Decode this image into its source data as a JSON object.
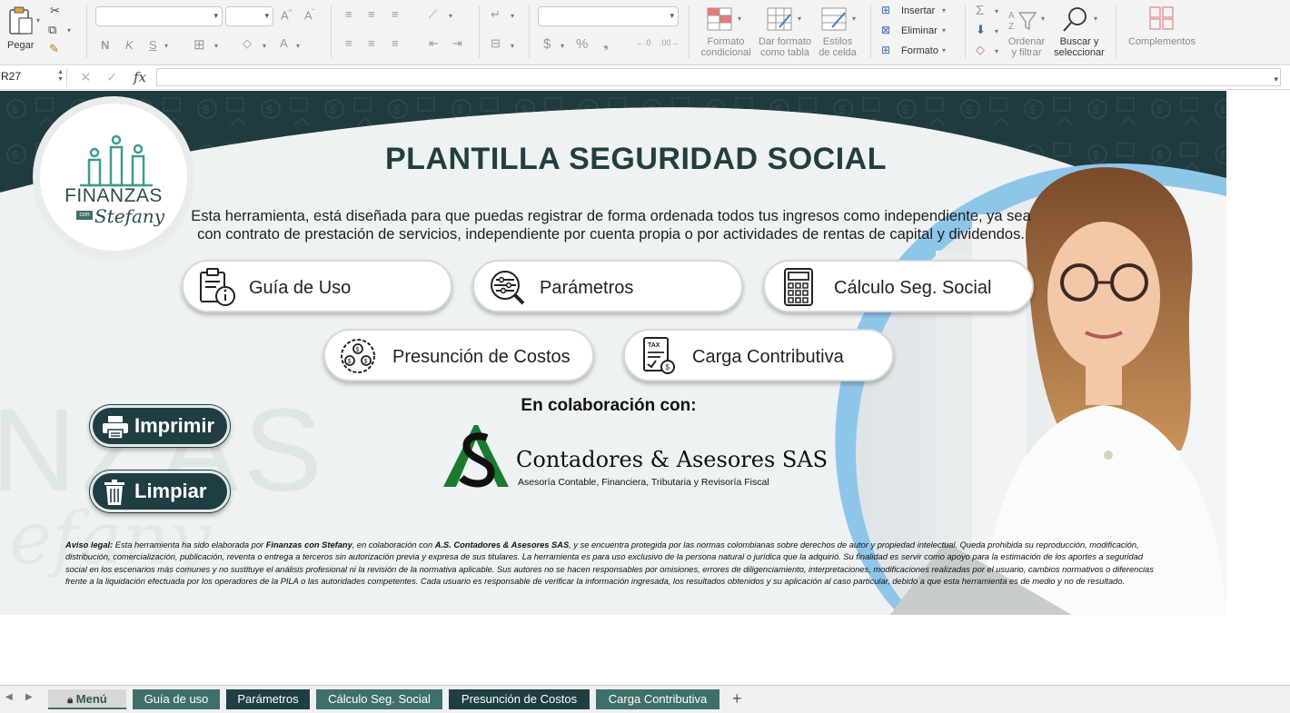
{
  "ribbon": {
    "paste_label": "Pegar",
    "cond_format_label_1": "Formato",
    "cond_format_label_2": "condicional",
    "table_format_label_1": "Dar formato",
    "table_format_label_2": "como tabla",
    "cell_styles_label_1": "Estilos",
    "cell_styles_label_2": "de celda",
    "insert_label": "Insertar",
    "delete_label": "Eliminar",
    "format_label": "Formato",
    "sort_label_1": "Ordenar",
    "sort_label_2": "y filtrar",
    "find_label_1": "Buscar y",
    "find_label_2": "seleccionar",
    "addins_label": "Complementos",
    "bold_glyph": "N",
    "italic_glyph": "K",
    "underline_glyph": "S",
    "currency_glyph": "$",
    "percent_glyph": "%",
    "thousands_glyph": "❟",
    "decimals_inc_glyph": "←.0",
    "decimals_dec_glyph": ".00→"
  },
  "formula_bar": {
    "cell_ref": "R27",
    "fx_label": "fx",
    "value": ""
  },
  "sheet": {
    "logo_text": "FINANZAS",
    "logo_script": "Stefany",
    "logo_small": "con",
    "title_part1": "PLANTILLA",
    "title_part2": "SEGURIDAD SOCIAL",
    "description_line1": "Esta herramienta, está diseñada para que puedas registrar de forma ordenada todos tus ingresos como independiente, ya sea",
    "description_line2": "con contrato de prestación de servicios, independiente por cuenta propia o por actividades de rentas de capital y dividendos.",
    "nav_buttons": [
      {
        "label": "Guía de Uso",
        "icon": "clipboard-info-icon"
      },
      {
        "label": "Parámetros",
        "icon": "parameters-search-icon"
      },
      {
        "label": "Cálculo Seg. Social",
        "icon": "calculator-icon"
      },
      {
        "label": "Presunción de Costos",
        "icon": "money-bulb-icon"
      },
      {
        "label": "Carga Contributiva",
        "icon": "tax-document-icon"
      }
    ],
    "print_label": "Imprimir",
    "clear_label": "Limpiar",
    "collab_label": "En colaboración con:",
    "partner_name": "Contadores & Asesores SAS",
    "partner_sub": "Asesoría Contable, Financiera, Tributaria y Revisoría Fiscal",
    "legal_lead": "Aviso legal:",
    "legal_text_1": "Esta herramienta ha sido elaborada por",
    "legal_brand": "Finanzas con Stefany",
    "legal_text_2": ", en colaboración con",
    "legal_partner": "A.S. Contadores & Asesores SAS",
    "legal_text_3": ", y se encuentra protegida por las normas colombianas sobre derechos de autor y propiedad intelectual. Queda prohibida su reproducción, modificación, distribución, comercialización, publicación, reventa o entrega a terceros sin autorización previa y expresa de sus titulares. La herramienta es para uso exclusivo de la persona natural o jurídica que la adquirió. Su finalidad es servir como apoyo para la estimación de los aportes a seguridad social en los escenarios más comunes y no sustituye el análisis profesional ni la revisión de la normativa aplicable. Sus autores no se hacen responsables por omisiones, errores de diligenciamiento, interpretaciones, modificaciones realizadas por el usuario, cambios normativos o diferencias frente a la liquidación efectuada por los operadores de la PILA o las autoridades competentes. Cada usuario es responsable de verificar la información ingresada, los resultados obtenidos y su aplicación al caso particular, debido a que esta herramienta es de medio y no de resultado."
  },
  "tabs": [
    {
      "label": "Menú",
      "style": "menu"
    },
    {
      "label": "Guía de uso",
      "style": "green"
    },
    {
      "label": "Parámetros",
      "style": "dark"
    },
    {
      "label": "Cálculo Seg. Social",
      "style": "green"
    },
    {
      "label": "Presunción de Costos",
      "style": "dark"
    },
    {
      "label": "Carga Contributiva",
      "style": "green"
    }
  ],
  "tab_add": "+",
  "colors": {
    "brand_dark": "#1f3e44",
    "brand_green": "#3f6f6a",
    "accent_blue": "#8ec6ea"
  }
}
